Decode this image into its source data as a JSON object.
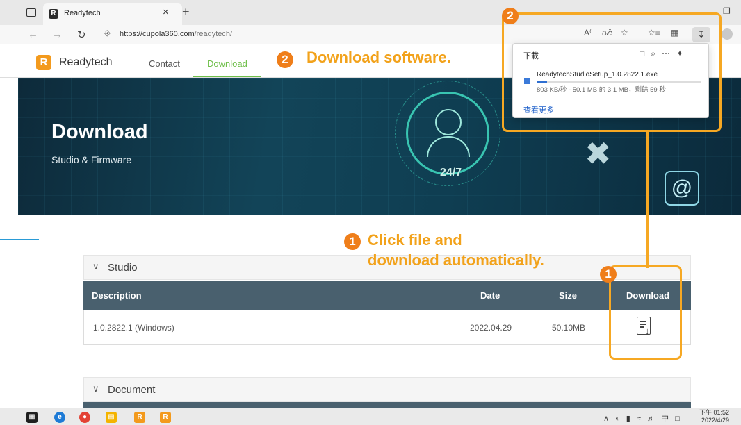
{
  "browser": {
    "tab_title": "Readytech",
    "tab_close": "×",
    "new_tab": "+",
    "url_host": "https://cupola360.com",
    "url_path": "/readytech/"
  },
  "site": {
    "brand": "Readytech",
    "logo_letter": "R",
    "nav": {
      "contact": "Contact",
      "download": "Download"
    }
  },
  "hero": {
    "title": "Download",
    "subtitle": "Studio & Firmware",
    "badge_247": "24/7",
    "at_symbol": "@"
  },
  "studio": {
    "section_label": "Studio",
    "columns": {
      "description": "Description",
      "date": "Date",
      "size": "Size",
      "download": "Download"
    },
    "row": {
      "description": "1.0.2822.1 (Windows)",
      "date": "2022.04.29",
      "size": "50.10MB"
    }
  },
  "document": {
    "section_label": "Document"
  },
  "annotations": {
    "step1_number": "1",
    "step1_line1": "Click file and",
    "step1_line2": "download automatically.",
    "step2_number": "2",
    "step2_text": "Download software."
  },
  "download_popup": {
    "header": "下載",
    "filename": "ReadytechStudioSetup_1.0.2822.1.exe",
    "progress_text": "803 KB/秒 - 50.1 MB 的 3.1 MB，剩餘 59 秒",
    "progress_fraction": 0.062,
    "see_more": "查看更多"
  },
  "taskbar": {
    "time": "下午 01:52",
    "date": "2022/4/29",
    "ime": "中"
  },
  "colors": {
    "accent_orange": "#f6a823",
    "badge_orange": "#ef7e1a",
    "nav_active_green": "#6fbf4a",
    "table_header": "#49606e"
  }
}
